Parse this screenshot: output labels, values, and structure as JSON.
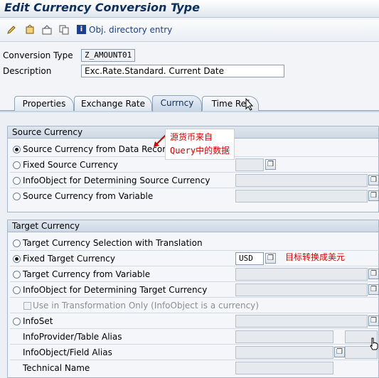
{
  "window": {
    "title": "Edit Currency Conversion Type"
  },
  "toolbar": {
    "obj_directory_label": "Obj. directory entry",
    "info_glyph": "i",
    "icons": [
      "edit-icon",
      "activate-icon",
      "check-icon",
      "copy-icon",
      "info-icon"
    ]
  },
  "header": {
    "conversion_type_label": "Conversion Type",
    "conversion_type_value": "Z_AMOUNT01",
    "description_label": "Description",
    "description_value": "Exc.Rate.Standard. Current Date"
  },
  "tabs": [
    {
      "label": "Properties",
      "active": false
    },
    {
      "label": "Exchange Rate",
      "active": false
    },
    {
      "label": "Currncy",
      "active": true
    },
    {
      "label": "Time Ref",
      "active": false
    }
  ],
  "source_currency": {
    "title": "Source Currency",
    "options": [
      {
        "label": "Source Currency from Data Record",
        "selected": true
      },
      {
        "label": "Fixed Source Currency",
        "selected": false
      },
      {
        "label": "InfoObject for Determining Source Currency",
        "selected": false
      },
      {
        "label": "Source Currency from Variable",
        "selected": false
      }
    ]
  },
  "target_currency": {
    "title": "Target Currency",
    "options": [
      {
        "label": "Target Currency Selection with Translation",
        "selected": false
      },
      {
        "label": "Fixed Target Currency",
        "selected": true,
        "value": "USD"
      },
      {
        "label": "Target Currency from Variable",
        "selected": false
      },
      {
        "label": "InfoObject for Determining Target Currency",
        "selected": false
      }
    ],
    "use_in_transformation_label": "Use in Transformation Only (InfoObject is a currency)",
    "infoset_label": "InfoSet",
    "infoprovider_label": "InfoProvider/Table Alias",
    "infoobject_field_label": "InfoObject/Field Alias",
    "technical_name_label": "Technical Name"
  },
  "annotations": {
    "source_note_line1": "源货币来自",
    "source_note_line2": "Query中的数据",
    "target_note": "目标转换成美元",
    "color": "#d40000"
  }
}
